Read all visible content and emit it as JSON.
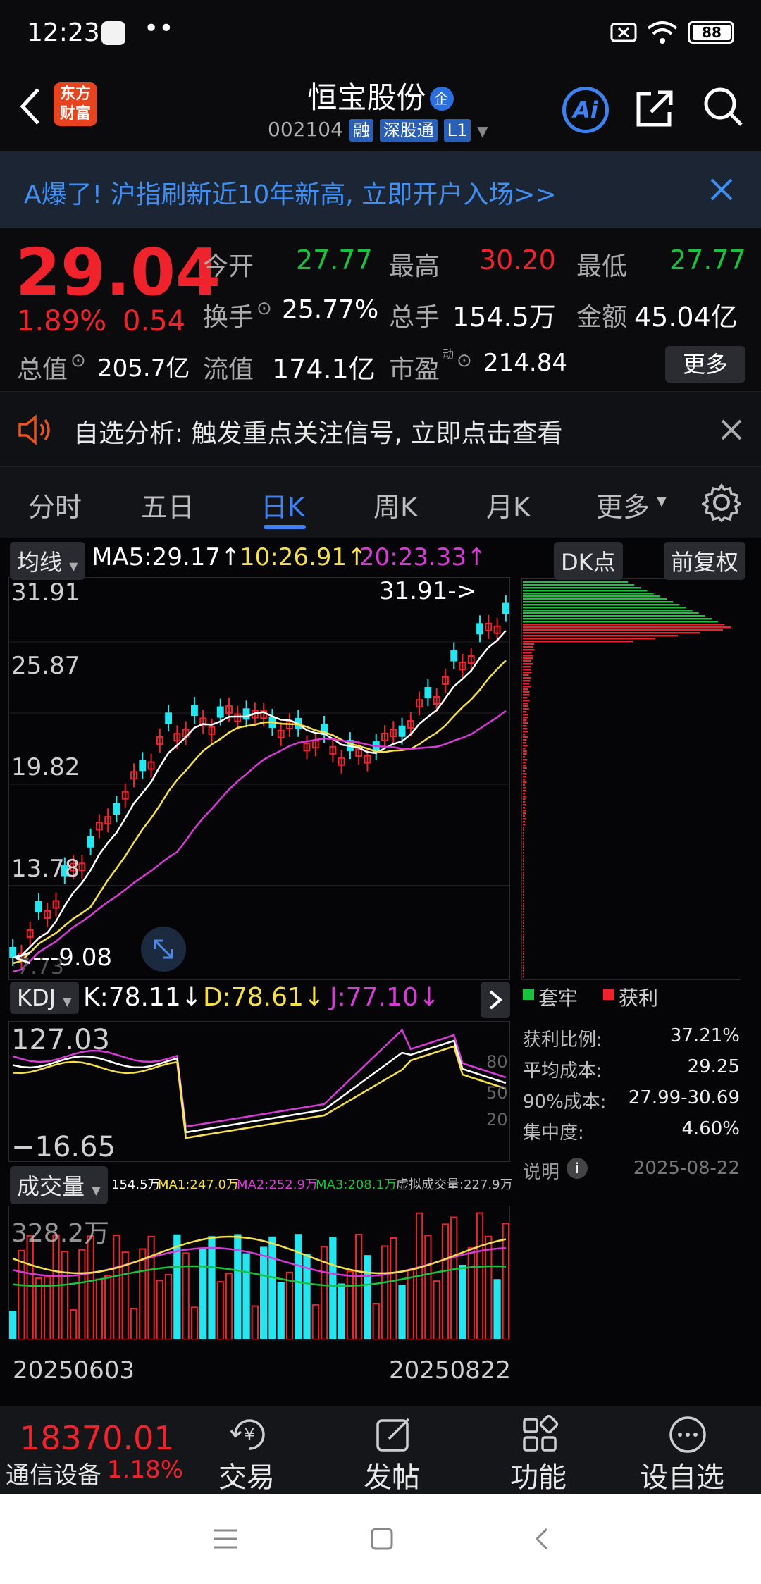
{
  "status_bar": {
    "time": "12:23",
    "dots": "••",
    "battery": "88"
  },
  "header": {
    "title": "恒宝股份",
    "title_badge": "企",
    "code": "002104",
    "tags": [
      "融",
      "深股通",
      "L1"
    ],
    "logo_text": [
      "东方",
      "财富"
    ],
    "ai_label": "Ai"
  },
  "banner": {
    "text": "A爆了! 沪指刷新近10年新高, 立即开户入场>>"
  },
  "quote": {
    "price": "29.04",
    "change_pct": "1.89%",
    "change_amt": "0.54",
    "open_label": "今开",
    "open_value": "27.77",
    "high_label": "最高",
    "high_value": "30.20",
    "low_label": "最低",
    "low_value": "27.77",
    "turnover_label": "换手",
    "turnover_value": "25.77%",
    "volume_label": "总手",
    "volume_value": "154.5万",
    "amount_label": "金额",
    "amount_value": "45.04亿",
    "mktcap_label": "总值",
    "mktcap_value": "205.7亿",
    "float_label": "流值",
    "float_value": "174.1亿",
    "pe_label": "市盈",
    "pe_sup": "动",
    "pe_value": "214.84",
    "more_button": "更多"
  },
  "notice": {
    "text": "自选分析: 触发重点关注信号, 立即点击查看"
  },
  "tabs": [
    "分时",
    "五日",
    "日K",
    "周K",
    "月K",
    "更多"
  ],
  "active_tab": "日K",
  "indicator_bar": {
    "selector": "均线",
    "ma5": "MA5:29.17",
    "ma10": "10:26.91",
    "ma20": "20:23.33",
    "dk_button": "DK点",
    "adjust_button": "前复权"
  },
  "main_chart": {
    "y_labels": [
      "31.91",
      "25.87",
      "19.82",
      "13.78"
    ],
    "high_marker": "31.91->",
    "low_marker": "<---9.08",
    "low_axis_fragment": "7.73"
  },
  "kdj": {
    "selector": "KDJ",
    "k": "K:78.11",
    "d": "D:78.61",
    "j": "J:77.10",
    "y_top": "127.03",
    "y_bottom": "−16.65",
    "levels": [
      "80",
      "50",
      "20"
    ]
  },
  "volume": {
    "selector": "成交量",
    "vol": "154.5万",
    "ma1": "MA1:247.0万",
    "ma2": "MA2:252.9万",
    "ma3": "MA3:208.1万",
    "virtual": "虚拟成交量:227.9万",
    "y_top": "328.2万",
    "date_start": "20250603",
    "date_end": "20250822"
  },
  "chip_panel": {
    "legend_trapped": "套牢",
    "legend_profit": "获利",
    "profit_ratio_label": "获利比例:",
    "profit_ratio_value": "37.21%",
    "avg_cost_label": "平均成本:",
    "avg_cost_value": "29.25",
    "cost90_label": "90%成本:",
    "cost90_value": "27.99-30.69",
    "concentration_label": "集中度:",
    "concentration_value": "4.60%",
    "note_label": "说明",
    "date": "2025-08-22"
  },
  "bottom_nav": {
    "index_value": "18370.01",
    "index_name": "通信设备",
    "index_change": "1.18%",
    "items": [
      "交易",
      "发帖",
      "功能",
      "设自选"
    ]
  },
  "colors": {
    "up": "#f0232d",
    "down": "#18c23c",
    "ma5": "#ffffff",
    "ma10": "#f5e04a",
    "ma20": "#d83ad8",
    "cyan": "#22e6f0"
  }
}
